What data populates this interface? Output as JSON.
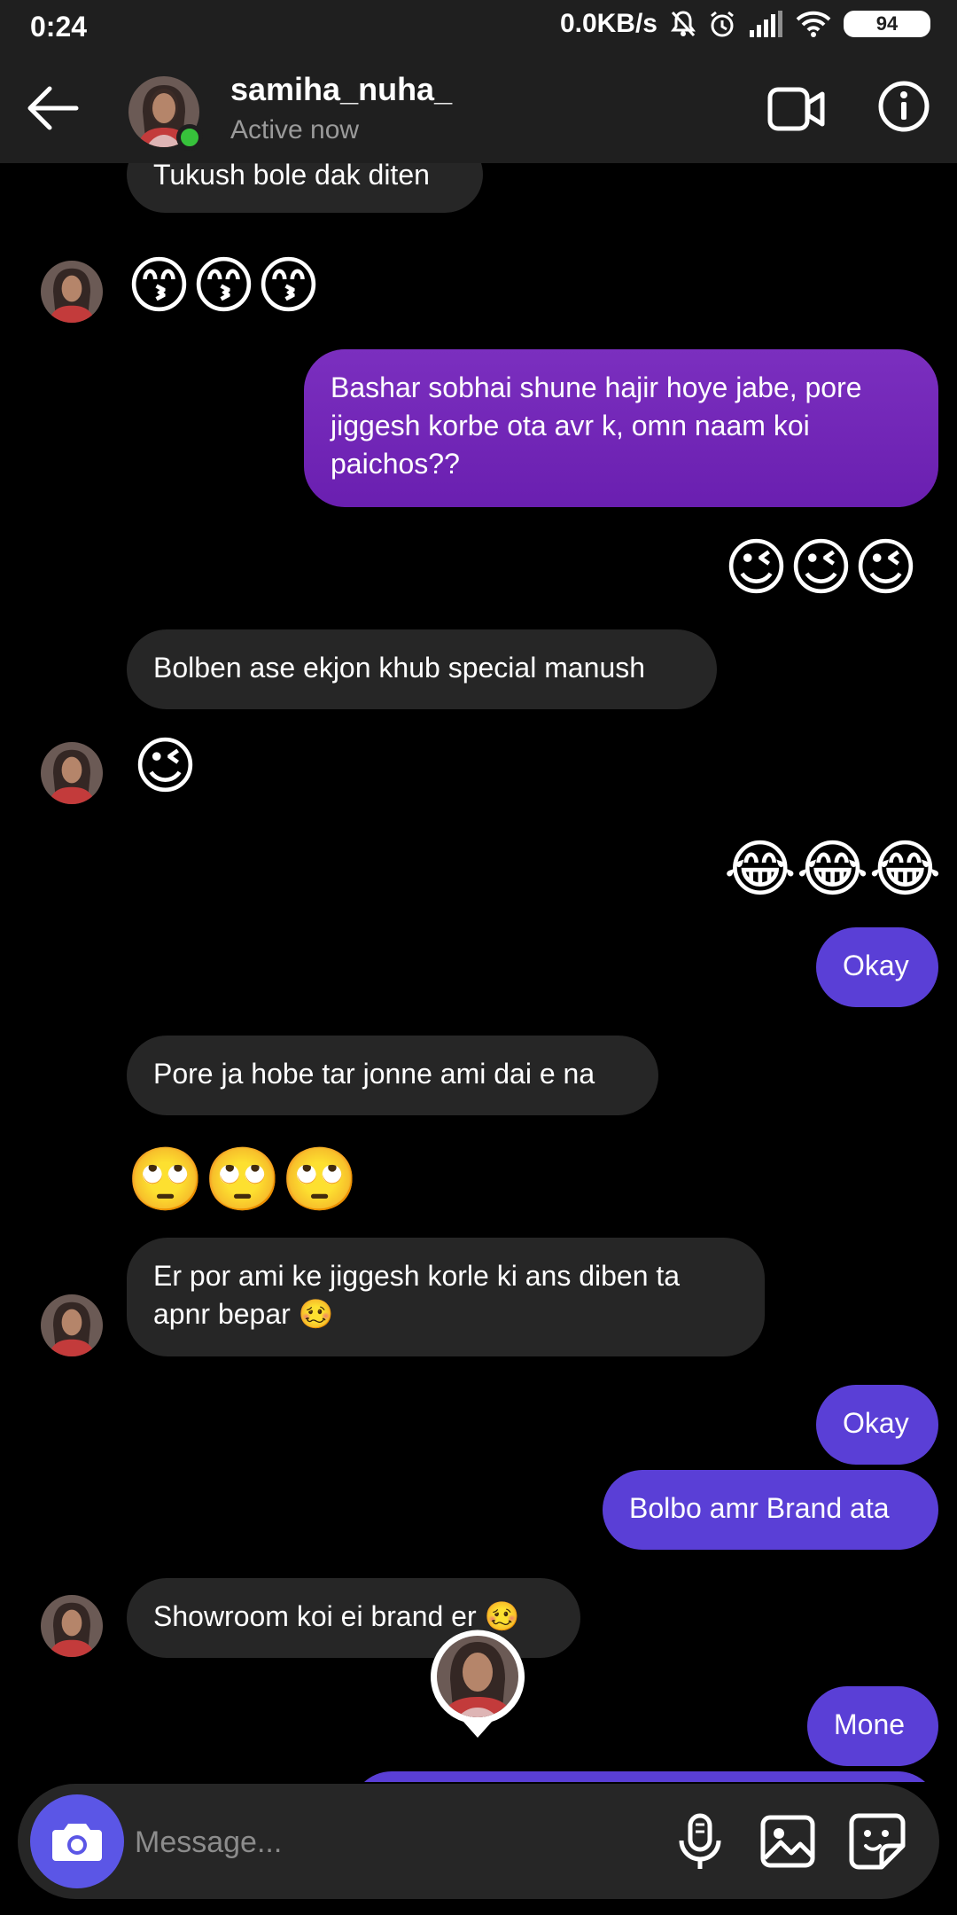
{
  "status_bar": {
    "time": "0:24",
    "net_speed": "0.0KB/s",
    "battery": "94"
  },
  "header": {
    "username": "samiha_nuha_",
    "status": "Active now"
  },
  "messages": [
    {
      "side": "in",
      "kind": "text",
      "text": "Tukush bole dak diten"
    },
    {
      "side": "in",
      "kind": "emoji",
      "text": "😙😙😙",
      "avatar": true
    },
    {
      "side": "out",
      "kind": "text",
      "text": "Bashar sobhai shune hajir hoye jabe, pore jiggesh korbe ota avr k, omn naam koi paichos??"
    },
    {
      "side": "out",
      "kind": "emoji",
      "text": "😉😉😉"
    },
    {
      "side": "in",
      "kind": "text",
      "text": "Bolben ase ekjon khub special manush"
    },
    {
      "side": "in",
      "kind": "emoji",
      "text": "😉",
      "avatar": true
    },
    {
      "side": "out",
      "kind": "emoji",
      "text": "😂😂😂"
    },
    {
      "side": "out",
      "kind": "text",
      "text": "Okay"
    },
    {
      "side": "in",
      "kind": "text",
      "text": "Pore ja hobe tar jonne ami dai e na"
    },
    {
      "side": "in",
      "kind": "emoji",
      "text": "🙄🙄🙄"
    },
    {
      "side": "in",
      "kind": "text",
      "text": "Er por ami ke jiggesh korle ki ans diben ta apnr bepar 🥴",
      "avatar": true
    },
    {
      "side": "out",
      "kind": "text",
      "text": "Okay"
    },
    {
      "side": "out",
      "kind": "text",
      "text": "Bolbo amr Brand ata"
    },
    {
      "side": "in",
      "kind": "text",
      "text": "Showroom koi ei brand er 🥴",
      "avatar": true
    },
    {
      "side": "out",
      "kind": "text",
      "text": "Mone"
    }
  ],
  "composer": {
    "placeholder": "Message..."
  },
  "colors": {
    "outgoing": "#5a3fd6",
    "outgoing_gradient": "#7b2fbf",
    "incoming": "#262626",
    "online": "#37c23b",
    "camera_button": "#5b56e6"
  },
  "icons": [
    "back-arrow-icon",
    "video-call-icon",
    "info-icon",
    "camera-icon",
    "microphone-icon",
    "gallery-icon",
    "sticker-icon"
  ]
}
